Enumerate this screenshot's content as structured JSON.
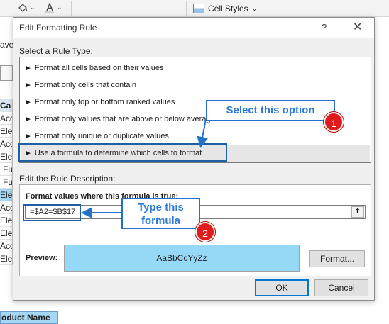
{
  "ribbon": {
    "fill_icon": "paint-bucket-icon",
    "font_color_icon": "font-color-icon",
    "cell_styles_label": "Cell Styles"
  },
  "sheet_fragments": {
    "ave": "ave",
    "rows": [
      "Ca",
      "Acc",
      "Elec",
      "Acc",
      "Elec",
      "Fu",
      "Fu",
      "Elec",
      "Acc",
      "Elec",
      "Elec",
      "Acc",
      "Elec"
    ],
    "bottom_cell": "oduct Name"
  },
  "dialog": {
    "title": "Edit Formatting Rule",
    "select_rule_label": "Select a Rule Type:",
    "rule_types": [
      "Format all cells based on their values",
      "Format only cells that contain",
      "Format only top or bottom ranked values",
      "Format only values that are above or below average",
      "Format only unique or duplicate values",
      "Use a formula to determine which cells to format"
    ],
    "selected_rule_index": 5,
    "edit_description_label": "Edit the Rule Description:",
    "formula_label": "Format values where this formula is true:",
    "formula_value": "=$A2=$B$17",
    "preview_label": "Preview:",
    "preview_text": "AaBbCcYyZz",
    "preview_fill": "#96d9f7",
    "format_button": "Format...",
    "ok_button": "OK",
    "cancel_button": "Cancel"
  },
  "annotations": {
    "callout_1": "Select this option",
    "callout_2_line1": "Type this",
    "callout_2_line2": "formula",
    "badge_1": "1",
    "badge_2": "2",
    "accent": "#2472c8",
    "badge_color": "#e01b1b"
  }
}
